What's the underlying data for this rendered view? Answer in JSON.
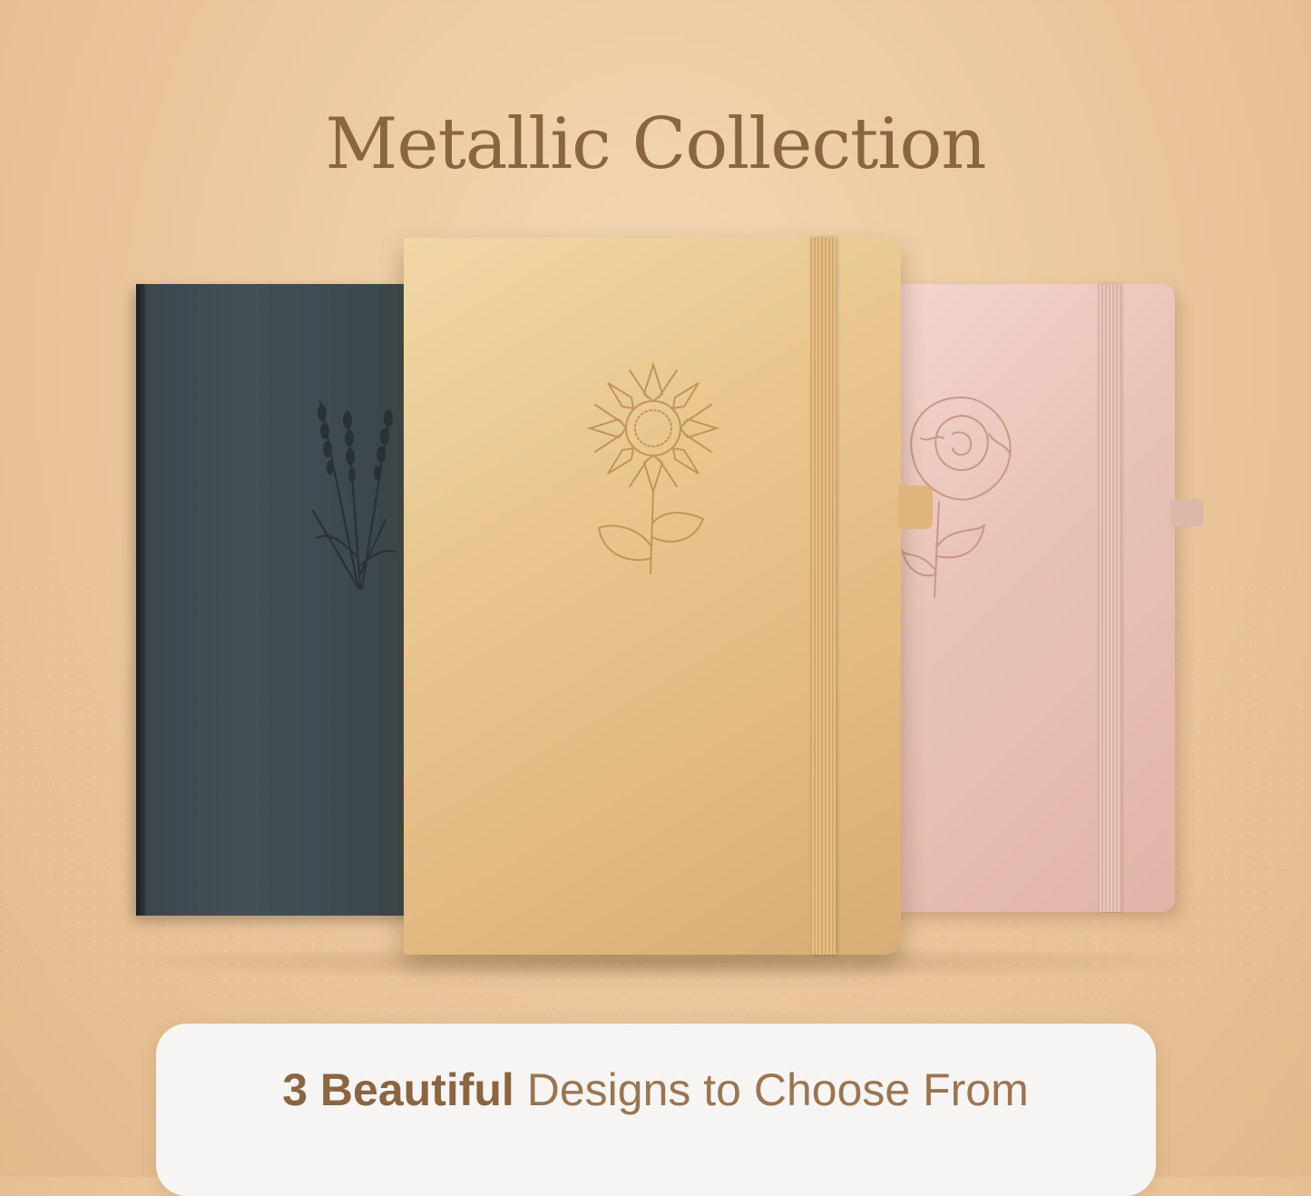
{
  "heading": {
    "title": "Metallic Collection"
  },
  "caption": {
    "bold": "3 Beautiful",
    "rest": "Designs to Choose From"
  },
  "notebooks": [
    {
      "name": "Lavender",
      "cover_color": "#3f4a4f",
      "emblem": "lavender-icon"
    },
    {
      "name": "Sunflower",
      "cover_color": "#e6c28a",
      "emblem": "sunflower-icon"
    },
    {
      "name": "Peony",
      "cover_color": "#ecc8bd",
      "emblem": "peony-icon"
    }
  ],
  "colors": {
    "text": "#8a6541",
    "background": "#ecc99f",
    "caption_bg": "#f7f5f4"
  }
}
